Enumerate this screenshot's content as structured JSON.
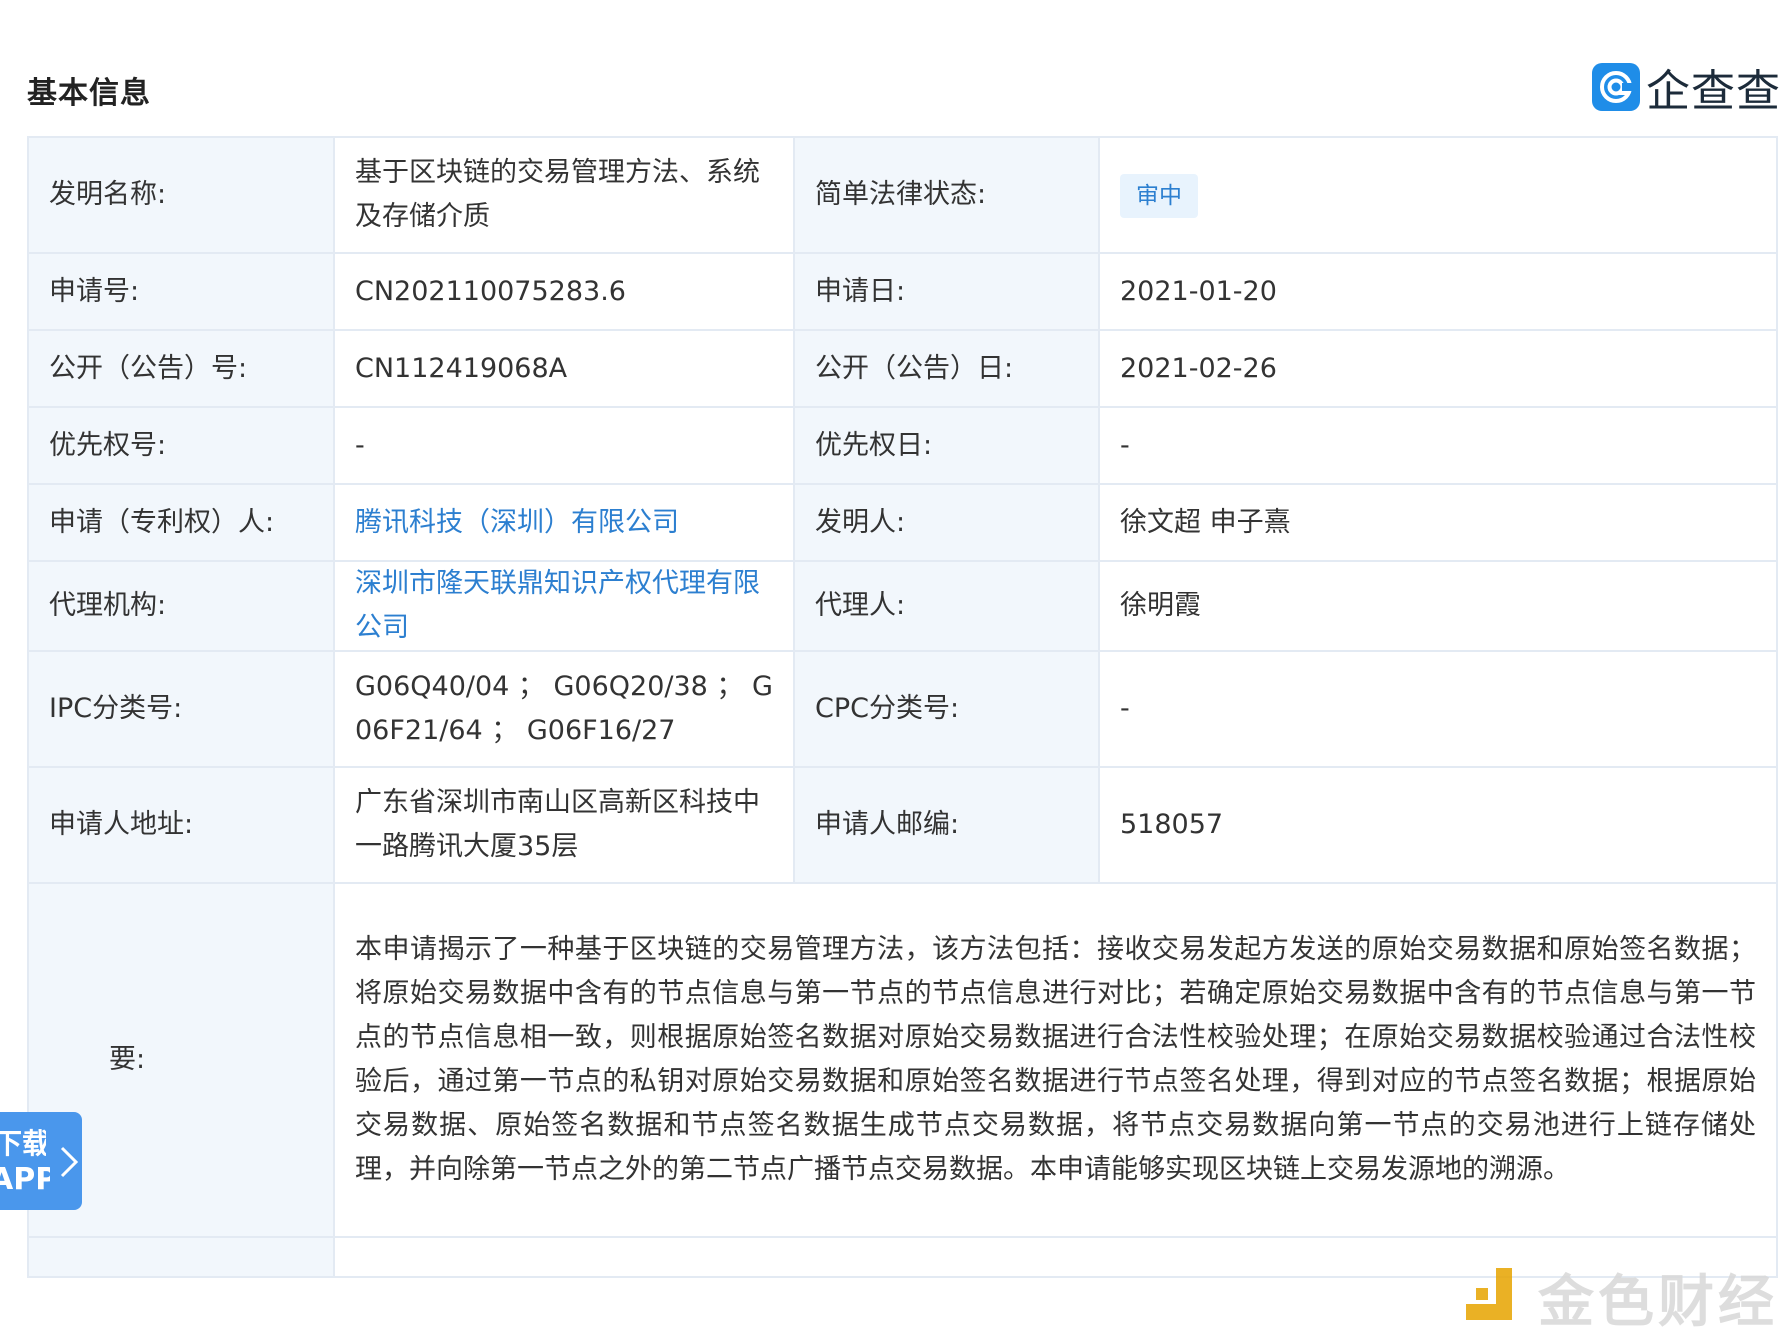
{
  "header": {
    "section_title": "基本信息",
    "brand_name": "企查查",
    "brand_icon": "qichacha-logo-icon"
  },
  "rows": {
    "invention_name_label": "发明名称:",
    "invention_name_value": "基于区块链的交易管理方法、系统及存储介质",
    "legal_status_label": "简单法律状态:",
    "legal_status_value": "审中",
    "application_no_label": "申请号:",
    "application_no_value": "CN202110075283.6",
    "application_date_label": "申请日:",
    "application_date_value": "2021-01-20",
    "publication_no_label": "公开（公告）号:",
    "publication_no_value": "CN112419068A",
    "publication_date_label": "公开（公告）日:",
    "publication_date_value": "2021-02-26",
    "priority_no_label": "优先权号:",
    "priority_no_value": "-",
    "priority_date_label": "优先权日:",
    "priority_date_value": "-",
    "applicant_label": "申请（专利权）人:",
    "applicant_value": "腾讯科技（深圳）有限公司",
    "inventor_label": "发明人:",
    "inventor_value": "徐文超 申子熹",
    "agency_label": "代理机构:",
    "agency_value": "深圳市隆天联鼎知识产权代理有限公司",
    "agent_label": "代理人:",
    "agent_value": "徐明霞",
    "ipc_label": "IPC分类号:",
    "ipc_value": "G06Q40/04 ； G06Q20/38 ； G06F21/64 ； G06F16/27",
    "cpc_label": "CPC分类号:",
    "cpc_value": "-",
    "address_label": "申请人地址:",
    "address_value": "广东省深圳市南山区高新区科技中一路腾讯大厦35层",
    "postcode_label": "申请人邮编:",
    "postcode_value": "518057",
    "abstract_label": "要:",
    "abstract_value": "本申请揭示了一种基于区块链的交易管理方法，该方法包括：接收交易发起方发送的原始交易数据和原始签名数据；将原始交易数据中含有的节点信息与第一节点的节点信息进行对比；若确定原始交易数据中含有的节点信息与第一节点的节点信息相一致，则根据原始签名数据对原始交易数据进行合法性校验处理；在原始交易数据校验通过合法性校验后，通过第一节点的私钥对原始交易数据和原始签名数据进行节点签名处理，得到对应的节点签名数据；根据原始交易数据、原始签名数据和节点签名数据生成节点交易数据，将节点交易数据向第一节点的交易池进行上链存储处理，并向除第一节点之外的第二节点广播节点交易数据。本申请能够实现区块链上交易发源地的溯源。"
  },
  "download_tab": {
    "line1": "下载",
    "line2": "APP",
    "icon": "chevron-right-icon"
  },
  "watermark": {
    "text": "金色财经",
    "icon": "jinse-logo-icon"
  },
  "colors": {
    "link": "#2c7fd0",
    "label_bg": "#f2f7fc",
    "border": "#e3eaf3",
    "badge_bg": "#e8f3fd",
    "tab_bg": "#4a97ec"
  }
}
